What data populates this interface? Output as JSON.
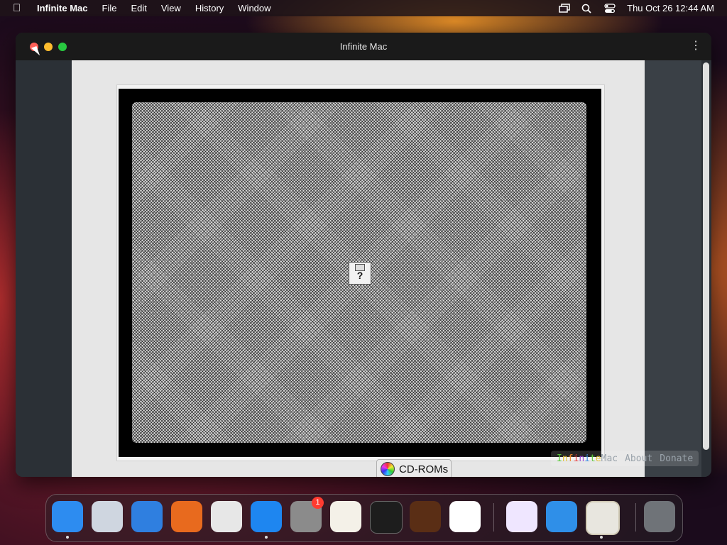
{
  "menubar": {
    "app_name": "Infinite Mac",
    "items": [
      "File",
      "Edit",
      "View",
      "History",
      "Window"
    ],
    "datetime": "Thu Oct 26  12:44 AM"
  },
  "window": {
    "title": "Infinite Mac"
  },
  "emulator": {
    "cd_roms_label": "CD-ROMs",
    "disk_glyph": "?"
  },
  "site_links": {
    "brand_letters": [
      {
        "ch": "I",
        "color": "#5ac63a"
      },
      {
        "ch": "n",
        "color": "#e2c23a"
      },
      {
        "ch": "f",
        "color": "#f08a2e"
      },
      {
        "ch": "i",
        "color": "#e23a3a"
      },
      {
        "ch": "n",
        "color": "#9a4ad6"
      },
      {
        "ch": "i",
        "color": "#3a8ae2"
      },
      {
        "ch": "t",
        "color": "#5ac63a"
      },
      {
        "ch": "e",
        "color": "#e2c23a"
      }
    ],
    "brand_suffix": "Mac",
    "about": "About",
    "donate": "Donate"
  },
  "dock": {
    "items": [
      {
        "name": "finder-icon",
        "color": "#2d8cf0"
      },
      {
        "name": "launchpad-icon",
        "color": "#cfd6e0"
      },
      {
        "name": "safari-icon",
        "color": "#2f7fe0"
      },
      {
        "name": "firefox-icon",
        "color": "#e86a1e"
      },
      {
        "name": "chrome-icon",
        "color": "#e7e7e7"
      },
      {
        "name": "app-store-icon",
        "color": "#1e86f0"
      },
      {
        "name": "system-settings-icon",
        "color": "#8b8b8b"
      },
      {
        "name": "textedit-icon",
        "color": "#f4f1e8"
      },
      {
        "name": "terminal-icon",
        "color": "#1d1d1d"
      },
      {
        "name": "garageband-icon",
        "color": "#5a2e15"
      },
      {
        "name": "vscode-icon",
        "color": "#ffffff"
      },
      {
        "name": "visual-studio-icon",
        "color": "#efe6ff"
      },
      {
        "name": "weather-icon",
        "color": "#2f8fe8"
      },
      {
        "name": "infinite-mac-app-icon",
        "color": "#e8e6df"
      },
      {
        "name": "trash-icon",
        "color": "#6f7378"
      }
    ],
    "settings_badge": "1"
  }
}
